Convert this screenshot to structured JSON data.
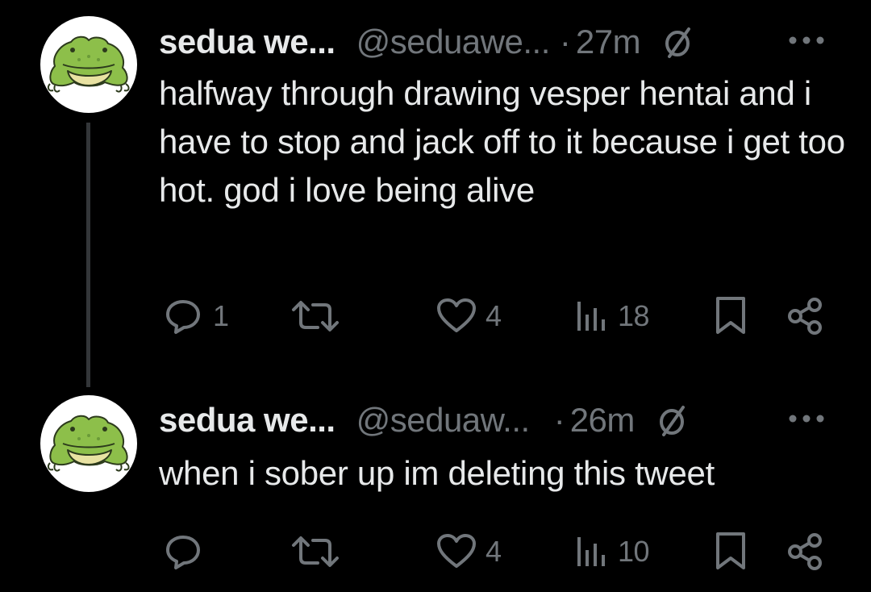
{
  "thread": {
    "tweets": [
      {
        "display_name": "sedua we...",
        "handle": "@seduawe...",
        "separator": "·",
        "time": "27m",
        "text": "halfway through drawing vesper hentai and i have to stop and jack off to it because i get too hot. god i love being alive",
        "reply_count": "1",
        "retweet_count": "",
        "like_count": "4",
        "view_count": "18"
      },
      {
        "display_name": "sedua we...",
        "handle": "@seduaw...",
        "separator": "·",
        "time": "26m",
        "text": "when i sober up im deleting this tweet",
        "reply_count": "",
        "retweet_count": "",
        "like_count": "4",
        "view_count": "10"
      }
    ]
  },
  "colors": {
    "background": "#000000",
    "primary_text": "#e7e9ea",
    "secondary_text": "#71767b",
    "thread_line": "#333639",
    "avatar_bg": "#ffffff",
    "frog_green": "#8dbf4a"
  },
  "icons": [
    "frog-avatar",
    "null-symbol-icon",
    "more-icon",
    "reply-icon",
    "retweet-icon",
    "like-icon",
    "views-icon",
    "bookmark-icon",
    "share-icon"
  ]
}
